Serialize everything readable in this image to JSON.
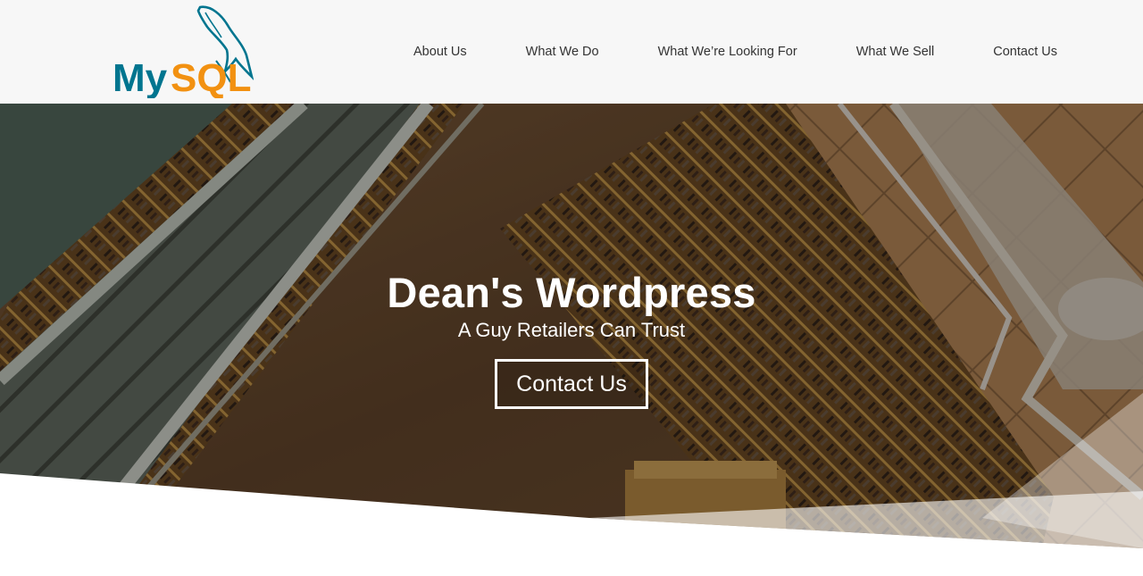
{
  "header": {
    "logo_text": "MySQL",
    "logo_colors": {
      "my": "#00758f",
      "sql": "#f29111"
    },
    "nav": [
      {
        "label": "About Us"
      },
      {
        "label": "What We Do"
      },
      {
        "label": "What We’re Looking For"
      },
      {
        "label": "What We Sell"
      },
      {
        "label": "Contact Us"
      }
    ]
  },
  "hero": {
    "title": "Dean's Wordpress",
    "subtitle": "A Guy Retailers Can Trust",
    "button_label": "Contact Us",
    "background": "aerial-store-escalator-photo"
  },
  "colors": {
    "header_bg": "#f7f7f7",
    "nav_text": "#333333",
    "hero_text": "#ffffff"
  }
}
